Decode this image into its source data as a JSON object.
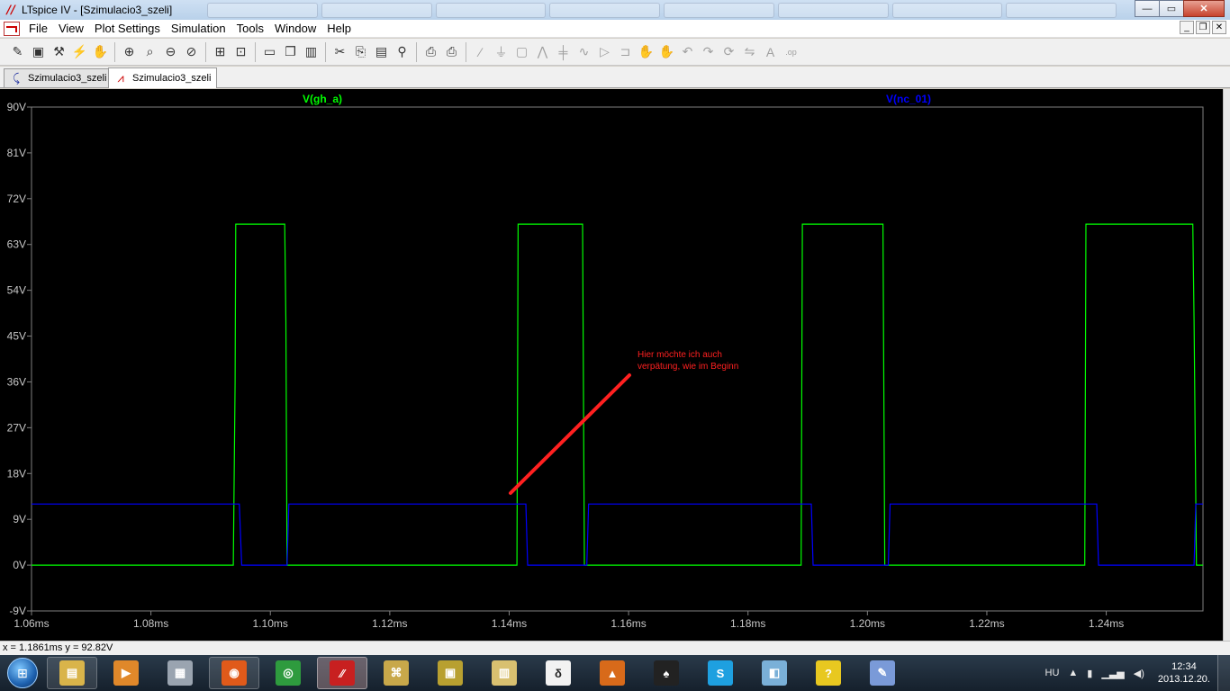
{
  "window": {
    "title": "LTspice IV - [Szimulacio3_szeli]",
    "controls": {
      "minimize": "—",
      "maximize": "▭",
      "close": "✕"
    }
  },
  "menu": {
    "items": [
      {
        "label": "File"
      },
      {
        "label": "View"
      },
      {
        "label": "Plot Settings"
      },
      {
        "label": "Simulation"
      },
      {
        "label": "Tools"
      },
      {
        "label": "Window"
      },
      {
        "label": "Help"
      }
    ],
    "mdi_controls": {
      "minimize": "_",
      "restore": "❐",
      "close": "✕"
    }
  },
  "toolbar": {
    "groups": [
      [
        "new-schematic-icon",
        "save-icon",
        "hammer-icon",
        "run-icon",
        "pan-hand-icon"
      ],
      [
        "zoom-in-icon",
        "zoom-area-icon",
        "zoom-out-icon",
        "zoom-cancel-icon"
      ],
      [
        "autorange-icon",
        "fit-icon"
      ],
      [
        "tile-horizontal-icon",
        "cascade-icon",
        "tile-vertical-icon"
      ],
      [
        "cut-icon",
        "copy-icon",
        "paste-icon",
        "find-icon"
      ],
      [
        "print-preview-icon",
        "print-icon"
      ],
      [
        "wire-icon",
        "ground-icon",
        "label-net-icon",
        "resistor-icon",
        "capacitor-icon",
        "inductor-icon",
        "diode-icon",
        "component-icon",
        "move-icon",
        "drag-icon",
        "undo-icon",
        "redo-icon",
        "rotate-icon",
        "mirror-icon",
        "text-icon",
        "spice-directive-icon"
      ]
    ]
  },
  "tabs": [
    {
      "label": "Szimulacio3_szeli",
      "icon": "schematic-icon",
      "active": false
    },
    {
      "label": "Szimulacio3_szeli",
      "icon": "waveform-icon",
      "active": true
    }
  ],
  "plot": {
    "background": "#000000",
    "grid_color": "#808080",
    "traces": [
      {
        "name": "V(gh_a)",
        "color": "#00ff00"
      },
      {
        "name": "V(nc_01)",
        "color": "#0000ff"
      }
    ],
    "y_ticks": [
      "90V",
      "81V",
      "72V",
      "63V",
      "54V",
      "45V",
      "36V",
      "27V",
      "18V",
      "9V",
      "0V",
      "-9V"
    ],
    "x_ticks": [
      "1.06ms",
      "1.08ms",
      "1.10ms",
      "1.12ms",
      "1.14ms",
      "1.16ms",
      "1.18ms",
      "1.20ms",
      "1.22ms",
      "1.24ms"
    ],
    "annotation": {
      "lines": [
        "Hier möchte ich auch",
        "verpätung, wie im Beginn"
      ],
      "color": "#ff2020"
    }
  },
  "chart_data": {
    "type": "line",
    "title": "",
    "xlabel": "",
    "ylabel": "",
    "xlim": [
      1.06,
      1.2562
    ],
    "ylim": [
      -9,
      90
    ],
    "x_unit": "ms",
    "y_unit": "V",
    "series": [
      {
        "name": "V(gh_a)",
        "color": "#00ff00",
        "points": [
          [
            1.06,
            0
          ],
          [
            1.0938,
            0
          ],
          [
            1.0941,
            36
          ],
          [
            1.0942,
            67
          ],
          [
            1.1024,
            67
          ],
          [
            1.1026,
            48
          ],
          [
            1.1028,
            0
          ],
          [
            1.1413,
            0
          ],
          [
            1.1415,
            67
          ],
          [
            1.1523,
            67
          ],
          [
            1.1526,
            0
          ],
          [
            1.1889,
            0
          ],
          [
            1.1891,
            67
          ],
          [
            1.2026,
            67
          ],
          [
            1.2029,
            0
          ],
          [
            1.2364,
            0
          ],
          [
            1.2366,
            67
          ],
          [
            1.2545,
            67
          ],
          [
            1.2547,
            48
          ],
          [
            1.2551,
            0
          ],
          [
            1.2562,
            0
          ]
        ]
      },
      {
        "name": "V(nc_01)",
        "color": "#0000ff",
        "points": [
          [
            1.06,
            12
          ],
          [
            1.0948,
            12
          ],
          [
            1.0952,
            0
          ],
          [
            1.1028,
            0
          ],
          [
            1.1031,
            12
          ],
          [
            1.1428,
            12
          ],
          [
            1.1431,
            0
          ],
          [
            1.153,
            0
          ],
          [
            1.1533,
            12
          ],
          [
            1.1906,
            12
          ],
          [
            1.1909,
            0
          ],
          [
            1.2035,
            0
          ],
          [
            1.2038,
            12
          ],
          [
            1.2384,
            12
          ],
          [
            1.2387,
            0
          ],
          [
            1.2547,
            0
          ],
          [
            1.255,
            12
          ],
          [
            1.2562,
            12
          ]
        ]
      }
    ]
  },
  "status": {
    "readout": "x = 1.1861ms    y = 92.82V"
  },
  "taskbar": {
    "start_icon": "windows-start-icon",
    "apps": [
      {
        "name": "explorer-icon",
        "glyph": "▤",
        "bg": "#d9b44a",
        "state": "open"
      },
      {
        "name": "media-player-icon",
        "glyph": "▶",
        "bg": "#e0882a",
        "state": "none"
      },
      {
        "name": "calculator-icon",
        "glyph": "▦",
        "bg": "#9aa4b0",
        "state": "none"
      },
      {
        "name": "firefox-icon",
        "glyph": "◉",
        "bg": "#e05a1a",
        "state": "open"
      },
      {
        "name": "chrome-icon",
        "glyph": "◎",
        "bg": "#2e9b3e",
        "state": "none"
      },
      {
        "name": "ltspice-icon",
        "glyph": "∕∕",
        "bg": "#c82020",
        "state": "active"
      },
      {
        "name": "network-app-icon",
        "glyph": "⌘",
        "bg": "#c8a84a",
        "state": "none"
      },
      {
        "name": "video-icon",
        "glyph": "▣",
        "bg": "#b8a030",
        "state": "none"
      },
      {
        "name": "chart-app-icon",
        "glyph": "▥",
        "bg": "#d8c070",
        "state": "none"
      },
      {
        "name": "document-app-icon",
        "glyph": "δ",
        "bg": "#f2f2f2",
        "state": "none"
      },
      {
        "name": "matlab-icon",
        "glyph": "▲",
        "bg": "#d86a1a",
        "state": "none"
      },
      {
        "name": "full-tilt-icon",
        "glyph": "♠",
        "bg": "#222222",
        "state": "none"
      },
      {
        "name": "skype-icon",
        "glyph": "S",
        "bg": "#1ea0e0",
        "state": "none"
      },
      {
        "name": "folder-app-icon",
        "glyph": "◧",
        "bg": "#7ab0d8",
        "state": "none"
      },
      {
        "name": "help-app-icon",
        "glyph": "?",
        "bg": "#e8c820",
        "state": "none"
      },
      {
        "name": "paint-icon",
        "glyph": "✎",
        "bg": "#7a9ad8",
        "state": "none"
      }
    ],
    "tray": {
      "language": "HU",
      "time": "12:34",
      "date": "2013.12.20."
    }
  }
}
